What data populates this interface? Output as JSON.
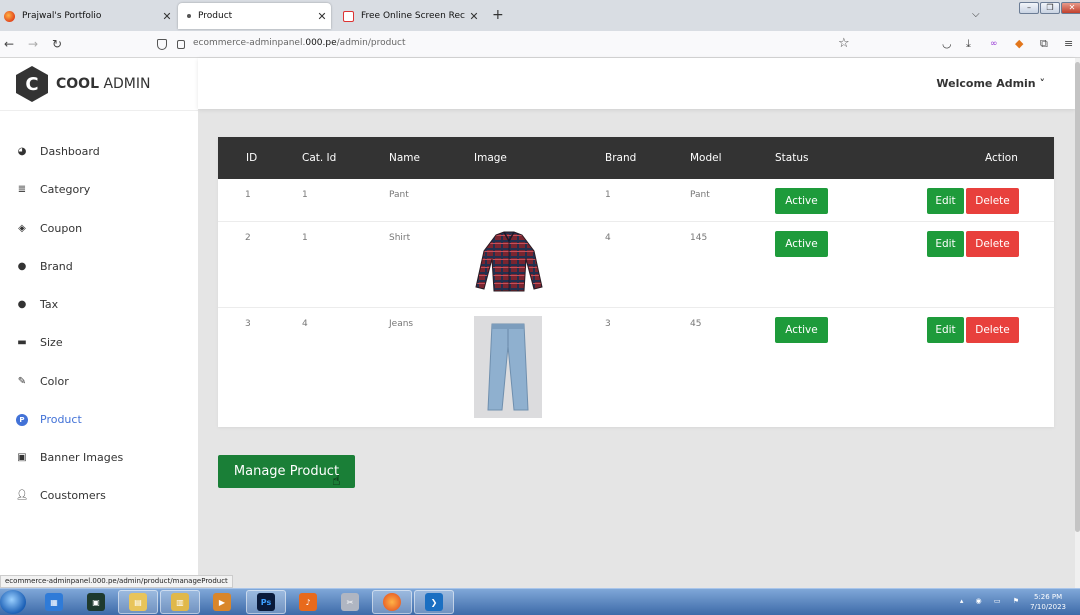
{
  "browser": {
    "tabs": [
      {
        "label": "Prajwal's Portfolio"
      },
      {
        "label": "Product"
      },
      {
        "label": "Free Online Screen Recorder &"
      }
    ],
    "url_prefix": "ecommerce-adminpanel.",
    "url_domain": "000.pe",
    "url_path": "/admin/product",
    "status_url": "ecommerce-adminpanel.000.pe/admin/product/manageProduct"
  },
  "brand": {
    "bold": "COOL",
    "light": " ADMIN",
    "letter": "C"
  },
  "header": {
    "welcome": "Welcome Admin"
  },
  "sidebar": {
    "items": [
      {
        "label": "Dashboard",
        "icon": "dashboard-icon"
      },
      {
        "label": "Category",
        "icon": "list-icon"
      },
      {
        "label": "Coupon",
        "icon": "tags-icon"
      },
      {
        "label": "Brand",
        "icon": "brand-icon"
      },
      {
        "label": "Tax",
        "icon": "tax-icon"
      },
      {
        "label": "Size",
        "icon": "size-icon"
      },
      {
        "label": "Color",
        "icon": "brush-icon"
      },
      {
        "label": "Product",
        "icon": "product-icon",
        "active": true
      },
      {
        "label": "Banner Images",
        "icon": "images-icon"
      },
      {
        "label": "Coustomers",
        "icon": "user-icon"
      }
    ]
  },
  "table": {
    "headers": [
      "ID",
      "Cat. Id",
      "Name",
      "Image",
      "Brand",
      "Model",
      "Status",
      "Action"
    ],
    "rows": [
      {
        "id": "1",
        "cat_id": "1",
        "name": "Pant",
        "image": "",
        "brand": "1",
        "model": "Pant",
        "status": "Active"
      },
      {
        "id": "2",
        "cat_id": "1",
        "name": "Shirt",
        "image": "plaid-shirt",
        "brand": "4",
        "model": "145",
        "status": "Active"
      },
      {
        "id": "3",
        "cat_id": "4",
        "name": "Jeans",
        "image": "blue-jeans",
        "brand": "3",
        "model": "45",
        "status": "Active"
      }
    ],
    "edit_label": "Edit",
    "delete_label": "Delete"
  },
  "actions": {
    "manage_product": "Manage Product"
  },
  "taskbar": {
    "time": "5:26 PM",
    "date": "7/10/2023"
  },
  "colors": {
    "accent": "#4272d7",
    "success": "#1e9b3b",
    "danger": "#e8403c",
    "header_dark": "#333333"
  }
}
